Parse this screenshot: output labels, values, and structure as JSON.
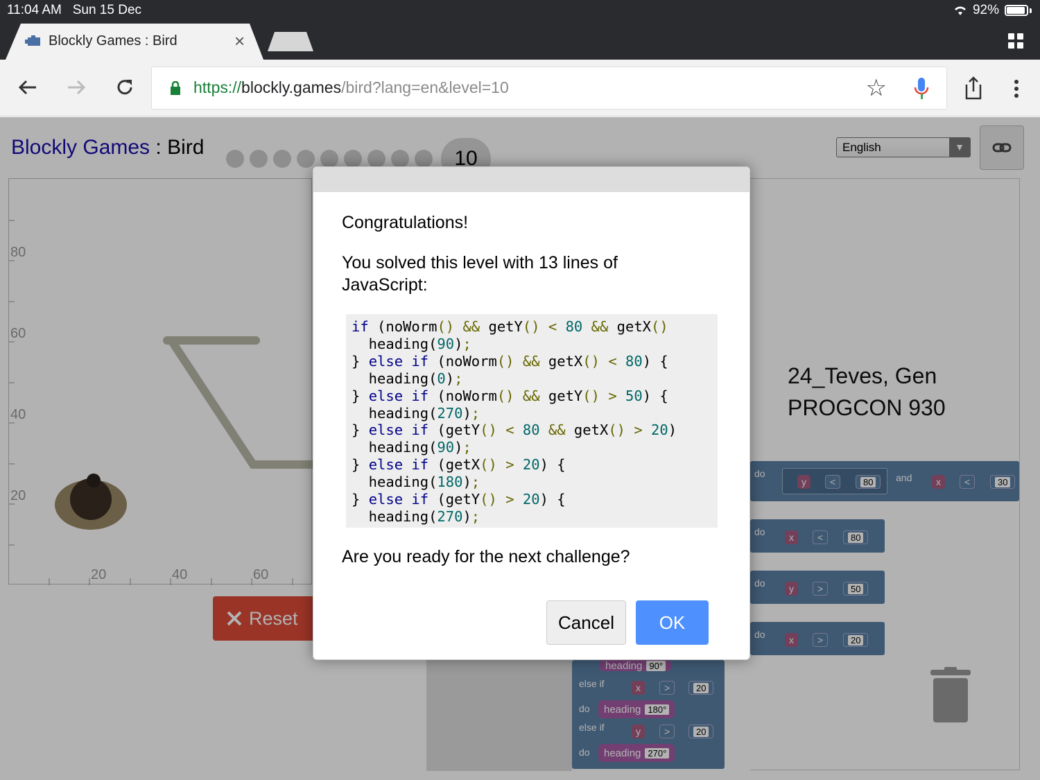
{
  "status_bar": {
    "time": "11:04 AM",
    "date": "Sun 15 Dec",
    "battery": "92%"
  },
  "tab": {
    "title": "Blockly Games : Bird",
    "close": "×"
  },
  "address_bar": {
    "scheme": "https://",
    "host": "blockly.games",
    "path": "/bird?lang=en&level=10"
  },
  "page": {
    "title_link": "Blockly Games",
    "title_sep": " : ",
    "title_game": "Bird",
    "current_level": "10",
    "language": "English",
    "y_axis": [
      "80",
      "60",
      "40",
      "20"
    ],
    "x_axis": [
      "20",
      "40",
      "60"
    ],
    "reset_label": "Reset"
  },
  "watermark": {
    "line1": "24_Teves, Gen",
    "line2": "PROGCON 930"
  },
  "blocks": {
    "do_label": "do",
    "else_if_label": "else if",
    "and_label": "and",
    "heading_label": "heading",
    "row1": {
      "var1": "y",
      "op1": "<",
      "num1": "80",
      "var2": "x",
      "op2": "<",
      "num2": "30"
    },
    "row2": {
      "var": "x",
      "op": "<",
      "num": "80"
    },
    "row3": {
      "var": "y",
      "op": ">",
      "num": "50"
    },
    "row4": {
      "var": "x",
      "op": ">",
      "num": "20"
    },
    "h90": "90°",
    "row5": {
      "var": "x",
      "op": ">",
      "num": "20"
    },
    "h180": "180°",
    "row6": {
      "var": "y",
      "op": ">",
      "num": "20"
    },
    "h270": "270°"
  },
  "dialog": {
    "title": "Congratulations!",
    "message_line1": "You solved this level with 13 lines of",
    "message_line2": "JavaScript:",
    "question": "Are you ready for the next challenge?",
    "cancel_label": "Cancel",
    "ok_label": "OK",
    "code_lines": [
      "if (noWorm() && getY() < 80 && getX()",
      "  heading(90);",
      "} else if (noWorm() && getX() < 80) {",
      "  heading(0);",
      "} else if (noWorm() && getY() > 50) {",
      "  heading(270);",
      "} else if (getY() < 80 && getX() > 20)",
      "  heading(90);",
      "} else if (getX() > 20) {",
      "  heading(180);",
      "} else if (getY() > 20) {",
      "  heading(270);"
    ]
  }
}
